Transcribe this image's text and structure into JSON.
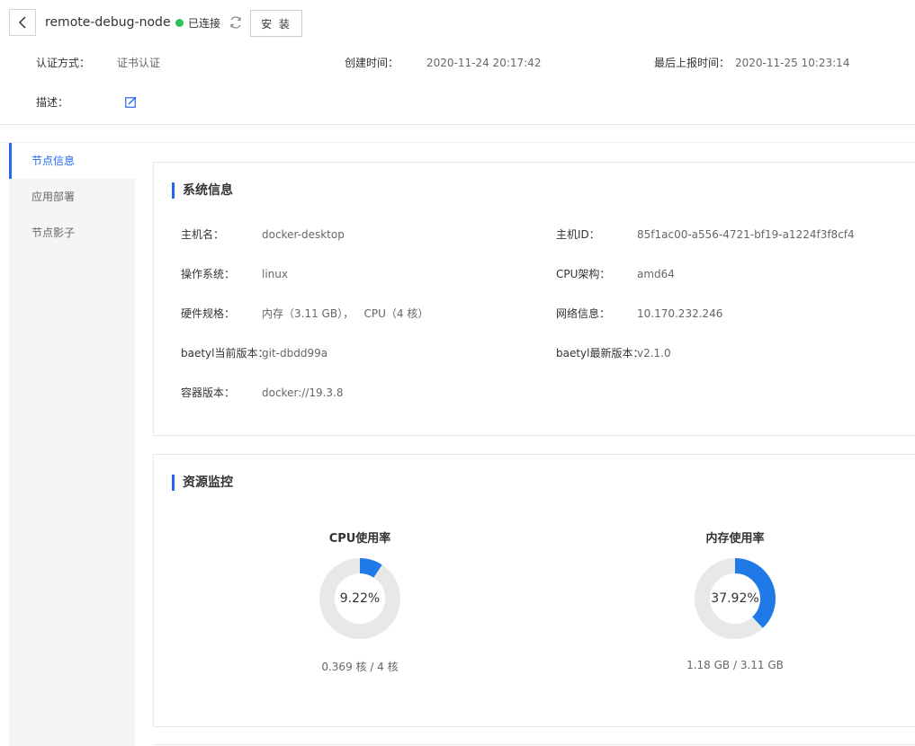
{
  "header": {
    "node_name": "remote-debug-node",
    "status": "已连接",
    "install_label": "安 装",
    "auth_label": "认证方式：",
    "auth_value": "证书认证",
    "created_label": "创建时间：",
    "created_value": "2020-11-24 20:17:42",
    "reported_label": "最后上报时间：",
    "reported_value": "2020-11-25 10:23:14",
    "desc_label": "描述："
  },
  "sidebar": {
    "items": [
      {
        "label": "节点信息",
        "active": true
      },
      {
        "label": "应用部署",
        "active": false
      },
      {
        "label": "节点影子",
        "active": false
      }
    ]
  },
  "system_info": {
    "title": "系统信息",
    "hostname_label": "主机名：",
    "hostname_value": "docker-desktop",
    "hostid_label": "主机ID：",
    "hostid_value": "85f1ac00-a556-4721-bf19-a1224f3f8cf4",
    "os_label": "操作系统：",
    "os_value": "linux",
    "arch_label": "CPU架构：",
    "arch_value": "amd64",
    "hw_label": "硬件规格：",
    "hw_value": "内存（3.11 GB），   CPU（4 核）",
    "net_label": "网络信息：",
    "net_value": "10.170.232.246",
    "baetyl_cur_label": "baetyl当前版本：",
    "baetyl_cur_value": "git-dbdd99a",
    "baetyl_new_label": "baetyl最新版本：",
    "baetyl_new_value": "v2.1.0",
    "container_label": "容器版本：",
    "container_value": "docker://19.3.8"
  },
  "monitor": {
    "title": "资源监控",
    "cpu_title": "CPU使用率",
    "cpu_percent_text": "9.22%",
    "cpu_percent": 9.22,
    "cpu_detail": "0.369 核 / 4 核",
    "mem_title": "内存使用率",
    "mem_percent_text": "37.92%",
    "mem_percent": 37.92,
    "mem_detail": "1.18 GB / 3.11 GB"
  },
  "colors": {
    "accent": "#2468f2",
    "gauge_fill": "#1f7ae8",
    "gauge_track": "#e8e8e8",
    "status_ok": "#2fc25b"
  },
  "icons": {
    "back": "chevron-left-icon",
    "refresh": "refresh-icon",
    "edit": "edit-icon"
  }
}
